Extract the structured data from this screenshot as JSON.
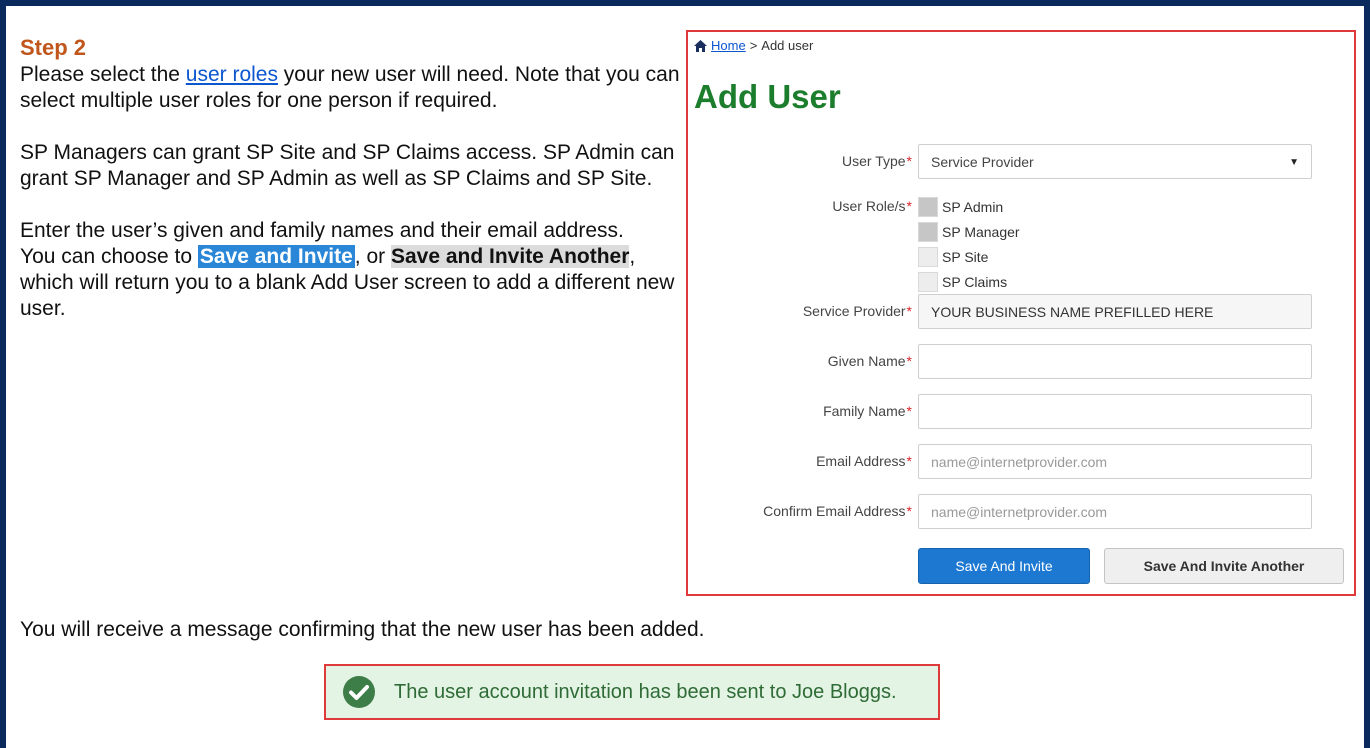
{
  "step": {
    "title": "Step 2",
    "p1_before": "Please select the ",
    "p1_link": "user roles",
    "p1_after": " your new user will need. Note that you can select multiple user roles for one person if required.",
    "p2": "SP Managers can grant SP Site and SP Claims access. SP Admin can grant SP Manager and SP Admin as well as SP Claims and SP Site.",
    "p3": "Enter the user’s given and family names and their email address.",
    "p4_before": "You can choose to ",
    "p4_hl1": "Save and Invite",
    "p4_mid": ", or ",
    "p4_hl2": "Save and Invite Another",
    "p4_after": ", which will return you to a blank Add User screen to add a different new user."
  },
  "form": {
    "breadcrumb": {
      "home": "Home",
      "separator": " > ",
      "current": "Add user"
    },
    "title": "Add User",
    "required_mark": "*",
    "user_type": {
      "label": "User Type",
      "value": "Service Provider"
    },
    "user_roles": {
      "label": "User Role/s",
      "options": [
        "SP Admin",
        "SP Manager",
        "SP Site",
        "SP Claims"
      ]
    },
    "service_provider": {
      "label": "Service Provider",
      "value": "YOUR BUSINESS NAME PREFILLED HERE"
    },
    "given_name": {
      "label": "Given Name",
      "value": ""
    },
    "family_name": {
      "label": "Family Name",
      "value": ""
    },
    "email": {
      "label": "Email Address",
      "placeholder": "name@internetprovider.com"
    },
    "confirm_email": {
      "label": "Confirm Email Address",
      "placeholder": "name@internetprovider.com"
    },
    "save_invite_label": "Save And Invite",
    "save_invite_another_label": "Save And Invite Another"
  },
  "confirmation": {
    "text": "You will receive a message confirming that the new user has been added.",
    "alert_text": "The user account invitation has been sent to Joe Bloggs."
  },
  "colors": {
    "frame": "#0a2a5e",
    "step_title": "#c0561b",
    "link": "#0b57d0",
    "page_title": "#1c7e2d",
    "primary_button": "#1c78d1",
    "highlight_border": "#e0393a",
    "alert_bg": "#e4f4e4"
  },
  "icons": {
    "home": "home-icon",
    "success": "check-circle-icon",
    "select": "dropdown-arrow-icon"
  }
}
